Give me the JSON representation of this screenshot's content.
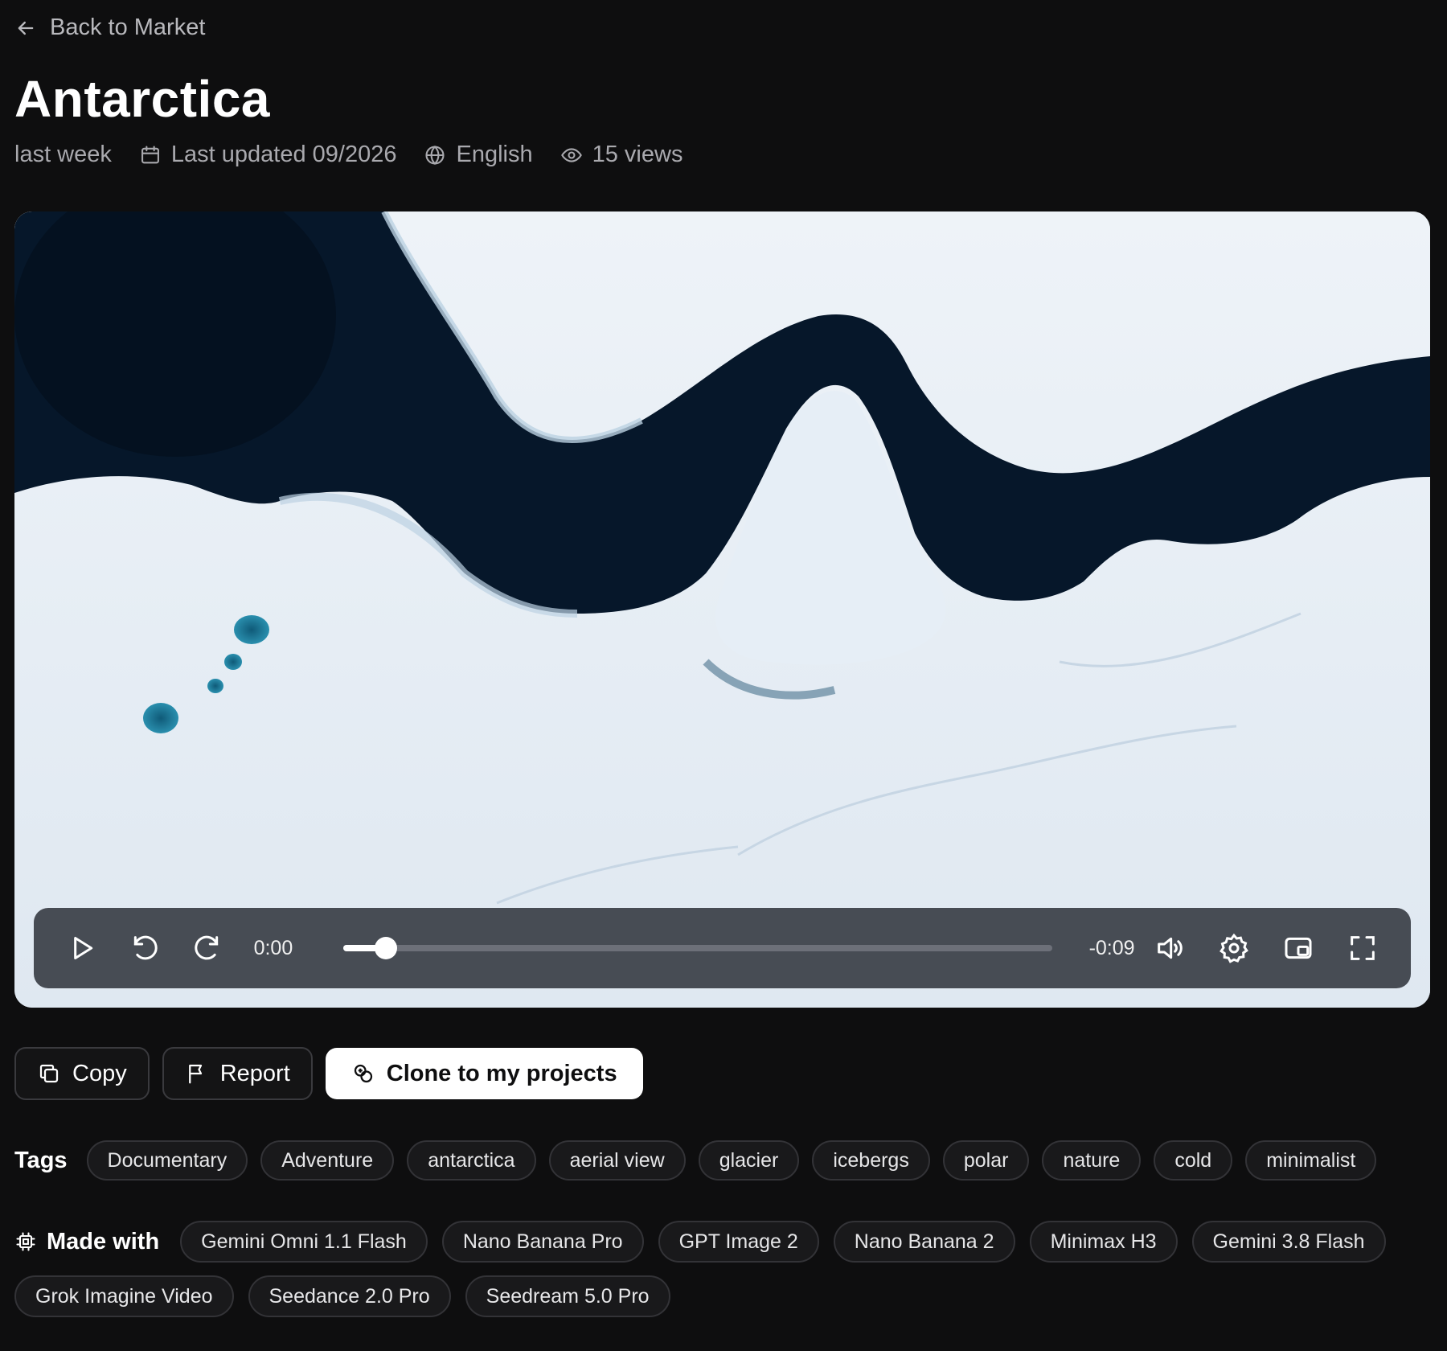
{
  "nav": {
    "back_label": "Back to Market",
    "back_icon": "arrow-left-icon"
  },
  "title": "Antarctica",
  "meta": {
    "posted": "last week",
    "updated": "Last updated 09/2026",
    "language": "English",
    "views": "15 views"
  },
  "player": {
    "current_time": "0:00",
    "remaining_time": "-0:09",
    "progress": 0.06
  },
  "actions": {
    "copy_label": "Copy",
    "report_label": "Report",
    "clone_label": "Clone to my projects"
  },
  "tags": {
    "label": "Tags",
    "items": [
      "Documentary",
      "Adventure",
      "antarctica",
      "aerial view",
      "glacier",
      "icebergs",
      "polar",
      "nature",
      "cold",
      "minimalist"
    ]
  },
  "made_with": {
    "label": "Made with",
    "items": [
      "Gemini Omni 1.1 Flash",
      "Nano Banana Pro",
      "GPT Image 2",
      "Nano Banana 2",
      "Minimax H3",
      "Gemini 3.8 Flash",
      "Grok Imagine Video",
      "Seedance 2.0 Pro",
      "Seedream 5.0 Pro"
    ]
  },
  "colors": {
    "background": "#0e0e0f",
    "ice": "#e9f0f6",
    "water": "#061729",
    "meltpond": "#1d6f8c"
  }
}
